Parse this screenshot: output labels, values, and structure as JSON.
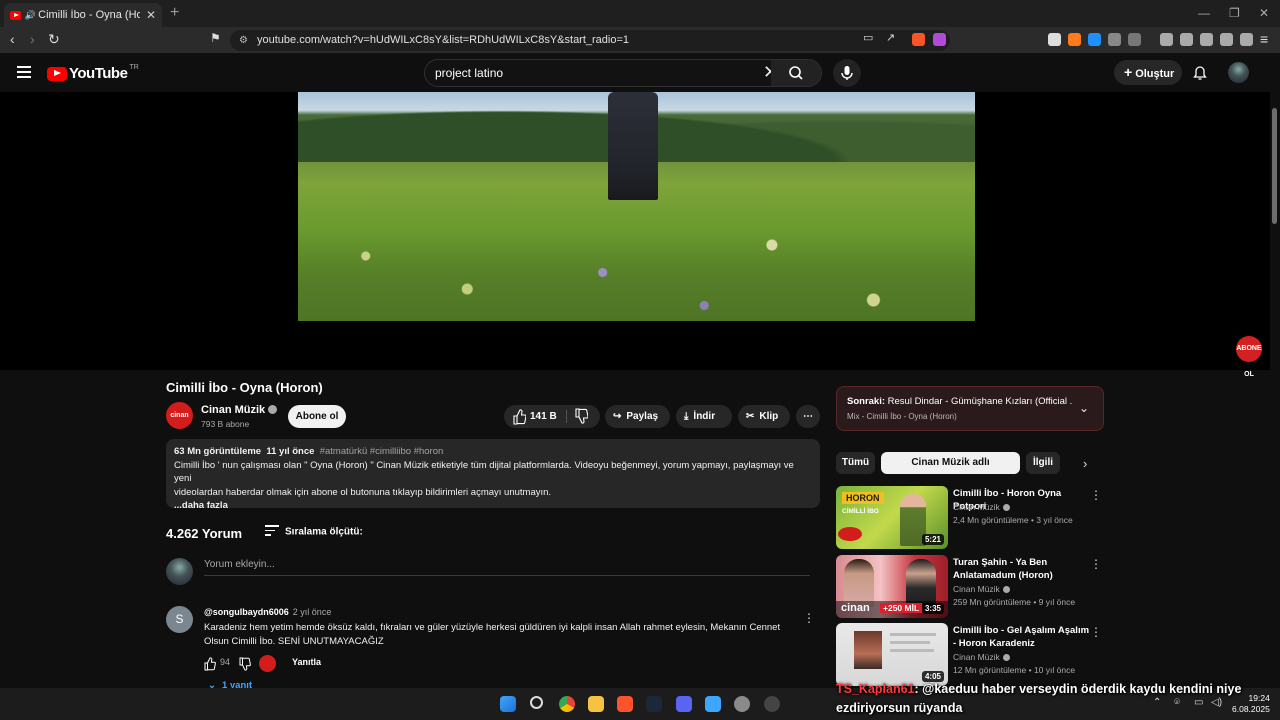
{
  "browser": {
    "tab_title": "Cimilli İbo - Oyna (Horon) - YouTube",
    "url": "youtube.com/watch?v=hUdWILxC8sY&list=RDhUdWILxC8sY&start_radio=1"
  },
  "header": {
    "logo_text": "YouTube",
    "country": "TR",
    "search_query": "project latino",
    "create_label": "Oluştur"
  },
  "video": {
    "title": "Cimilli İbo - Oyna (Horon)",
    "channel": "Cinan Müzik",
    "channel_avatar_text": "cinan",
    "subscribers": "793 B abone",
    "subscribe_label": "Abone ol",
    "likes": "141 B",
    "share_label": "Paylaş",
    "download_label": "İndir",
    "clip_label": "Klip",
    "overlay_badge": "ABONE OL"
  },
  "description": {
    "views": "63 Mn görüntüleme",
    "age": "11 yıl önce",
    "tags": "#atmatürkü #cimilliibo #horon",
    "line1": "Cimilli İbo ' nun çalışması olan \" Oyna (Horon) \" Cinan Müzik etiketiyle tüm dijital platformlarda. Videoyu beğenmeyi, yorum yapmayı, paylaşmayı ve yeni",
    "line2": "videolardan haberdar olmak için abone ol butonuna tıklayıp bildirimleri açmayı unutmayın.",
    "more": "...daha fazla"
  },
  "comments": {
    "count": "4.262 Yorum",
    "sort_label": "Sıralama ölçütü:",
    "add_placeholder": "Yorum ekleyin...",
    "items": [
      {
        "avatar_letter": "S",
        "user": "@songulbaydn6006",
        "ago": "2 yıl önce",
        "text": "Karadeniz hem yetim hemde öksüz kaldı, fıkraları ve güler yüzüyle herkesi güldüren iyi kalpli insan Allah rahmet eylesin, Mekanın Cennet Olsun Cimilli İbo. SENİ UNUTMAYACAĞIZ",
        "likes": "94",
        "reply_label": "Yanıtla",
        "replies": "1 yanıt"
      }
    ]
  },
  "sidebar": {
    "next_prefix": "Sonraki:",
    "next_title": "Resul Dindar - Gümüşhane Kızları (Official ...",
    "next_sub": "Mix - Cimilli İbo - Oyna (Horon)",
    "chips": [
      "Tümü",
      "Cinan Müzik adlı yükleyiciden",
      "İlgili"
    ],
    "videos": [
      {
        "title": "Cimilli İbo - Horon Oyna Potpori",
        "channel": "Cinan Müzik",
        "meta": "2,4 Mn görüntüleme • 3 yıl önce",
        "duration": "5:21",
        "thumb_text": "HORON",
        "thumb_sub": "CİMİLLİ İBO"
      },
      {
        "title": "Turan Şahin - Ya Ben Anlatamadum (Horon)",
        "channel": "Cinan Müzik",
        "meta": "259 Mn görüntüleme • 9 yıl önce",
        "duration": "3:35",
        "thumb_text": "+250 MİL",
        "thumb_sub": "cinan"
      },
      {
        "title": "Cimilli İbo - Gel Aşalım Aşalım - Horon Karadeniz",
        "channel": "Cinan Müzik",
        "meta": "12 Mn görüntüleme • 10 yıl önce",
        "duration": "4:05",
        "thumb_text": "",
        "thumb_sub": ""
      }
    ]
  },
  "overlay_chat": {
    "name": "TS_Kaplan61",
    "message": ": @kaeduu haber verseydin öderdik kaydu kendini niye ezdiriyorsun rüyanda"
  },
  "taskbar": {
    "time": "19:24",
    "date": "6.08.2025"
  },
  "colors": {
    "yt_red": "#ff0000",
    "bg": "#0f0f0f",
    "surface": "#272727",
    "link_blue": "#3ea6ff"
  }
}
